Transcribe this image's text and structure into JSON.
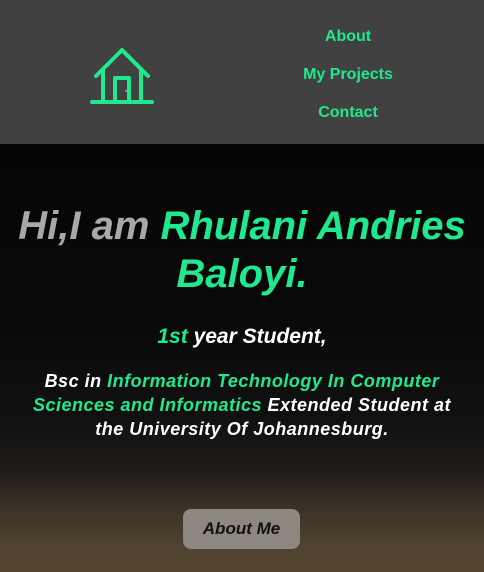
{
  "nav": {
    "logo_icon": "house-icon",
    "links": [
      {
        "label": "About"
      },
      {
        "label": "My Projects"
      },
      {
        "label": "Contact"
      }
    ]
  },
  "hero": {
    "greeting": "Hi,I am ",
    "name": "Rhulani Andries Baloyi.",
    "year_highlight": "1st",
    "year_rest": " year Student,",
    "desc_prefix": "Bsc in ",
    "desc_program": "Information Technology In Computer Sciences and Informatics",
    "desc_suffix": " Extended Student at the University Of Johannesburg.",
    "button_label": "About Me"
  },
  "colors": {
    "accent": "#1fe98f",
    "navbar_bg": "#414141",
    "greeting_gray": "#a8a8a8",
    "button_bg": "#8d8780"
  }
}
